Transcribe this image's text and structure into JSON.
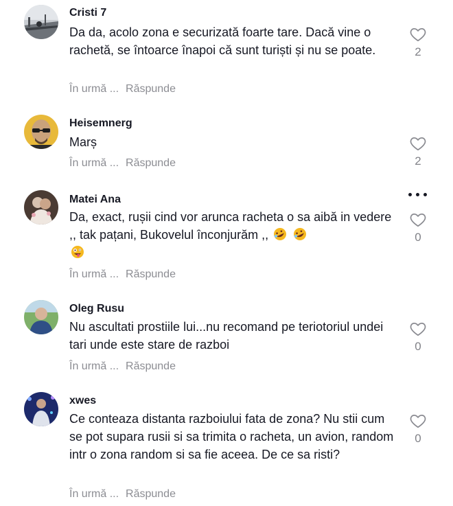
{
  "comments": [
    {
      "username": "Cristi 7",
      "text": "Da da, acolo zona e securizată foarte tare. Dacă vine o rachetă, se întoarce înapoi că sunt turiști și nu se poate.",
      "time": "În urmă ...",
      "reply": "Răspunde",
      "likes": "2",
      "avatar": "avatar-road-photo"
    },
    {
      "username": "Heisemnerg",
      "text": "Marș",
      "time": "În urmă ...",
      "reply": "Răspunde",
      "likes": "2",
      "avatar": "avatar-bald-man-glasses"
    },
    {
      "username": "Matei Ana",
      "text": "Da, exact, rușii cind vor arunca racheta o sa aibă in vedere ,, tak pațani, Bukovelul înconjurăm ,,",
      "emojis": [
        "rofl-emoji",
        "rofl-emoji",
        "zany-face-emoji"
      ],
      "time": "În urmă ...",
      "reply": "Răspunde",
      "likes": "0",
      "avatar": "avatar-couple-photo"
    },
    {
      "username": "Oleg Rusu",
      "text": "Nu ascultati prostiile lui...nu recomand pe teriotoriul undei tari unde este stare de razboi",
      "time": "În urmă ...",
      "reply": "Răspunde",
      "likes": "0",
      "avatar": "avatar-man-outdoors"
    },
    {
      "username": "xwes",
      "text": "Ce conteaza distanta razboiului fata de zona? Nu stii cum se pot supara rusii si sa trimita o racheta, un avion, random intr o zona random si sa fie aceea. De ce sa risti?",
      "time": "În urmă ...",
      "reply": "Răspunde",
      "likes": "0",
      "avatar": "avatar-man-night-lights"
    }
  ],
  "colors": {
    "text": "#161823",
    "muted": "#8a8b91",
    "icon": "#8a8b91"
  }
}
